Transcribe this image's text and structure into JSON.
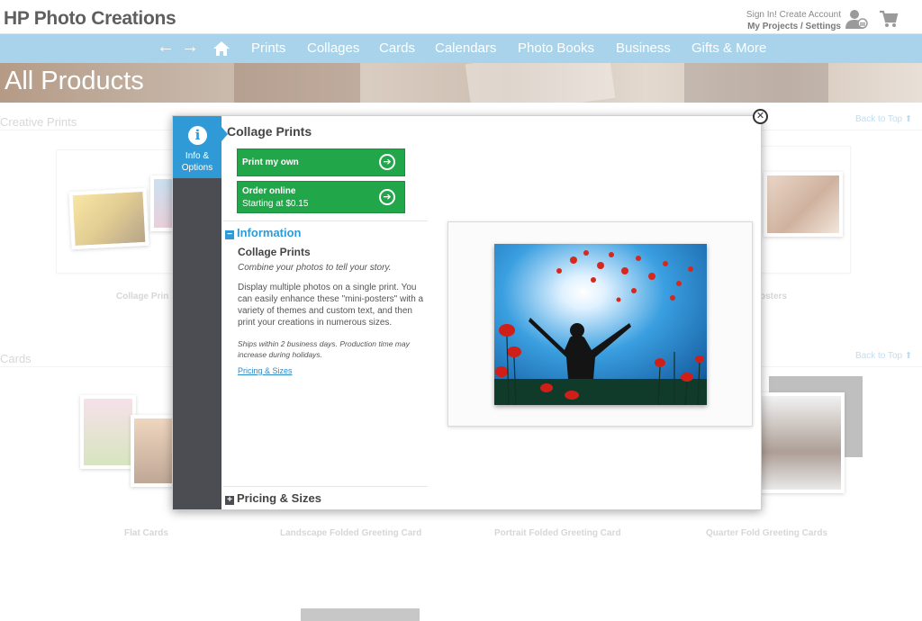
{
  "header": {
    "brand": "HP Photo Creations",
    "account_line1": "Sign In! Create Account",
    "account_line2": "My Projects / Settings"
  },
  "nav": {
    "back_arrow": "←",
    "forward_arrow": "→",
    "items": [
      "Prints",
      "Collages",
      "Cards",
      "Calendars",
      "Photo Books",
      "Business",
      "Gifts & More"
    ]
  },
  "hero": {
    "title": "All Products"
  },
  "sections": {
    "creative_prints": {
      "title": "Creative Prints",
      "back_to_top": "Back to Top ⬆"
    },
    "cards": {
      "title": "Cards",
      "back_to_top": "Back to Top ⬆"
    }
  },
  "products": {
    "collage_label": "Collage Prin",
    "posters_label": "osters",
    "cards": [
      "Flat Cards",
      "Landscape Folded Greeting Card",
      "Portrait Folded Greeting Card",
      "Quarter Fold Greeting Cards"
    ]
  },
  "modal": {
    "tab_label_1": "Info &",
    "tab_label_2": "Options",
    "title": "Collage Prints",
    "print_own": "Print my own",
    "order_online": "Order online",
    "order_sub": "Starting at $0.15",
    "info_header": "Information",
    "info_subtitle": "Collage Prints",
    "info_tagline": "Combine your photos to tell your story.",
    "info_body": "Display multiple photos on a single print. You can easily enhance these \"mini-posters\" with a variety of themes and custom text, and then print your creations in numerous sizes.",
    "info_shipping": "Ships within 2 business days. Production time may increase during holidays.",
    "info_link": "Pricing & Sizes",
    "pricing_header": "Pricing & Sizes"
  },
  "colors": {
    "nav_bg": "#a8d3ea",
    "accent_blue": "#2f9ad6",
    "button_green": "#22a64a",
    "sidebar_dark": "#4c4d52"
  },
  "icons": [
    "user-icon",
    "cart-icon",
    "home-icon",
    "info-icon",
    "arrow-right-circle-icon",
    "close-icon",
    "minus-box-icon",
    "plus-box-icon"
  ]
}
